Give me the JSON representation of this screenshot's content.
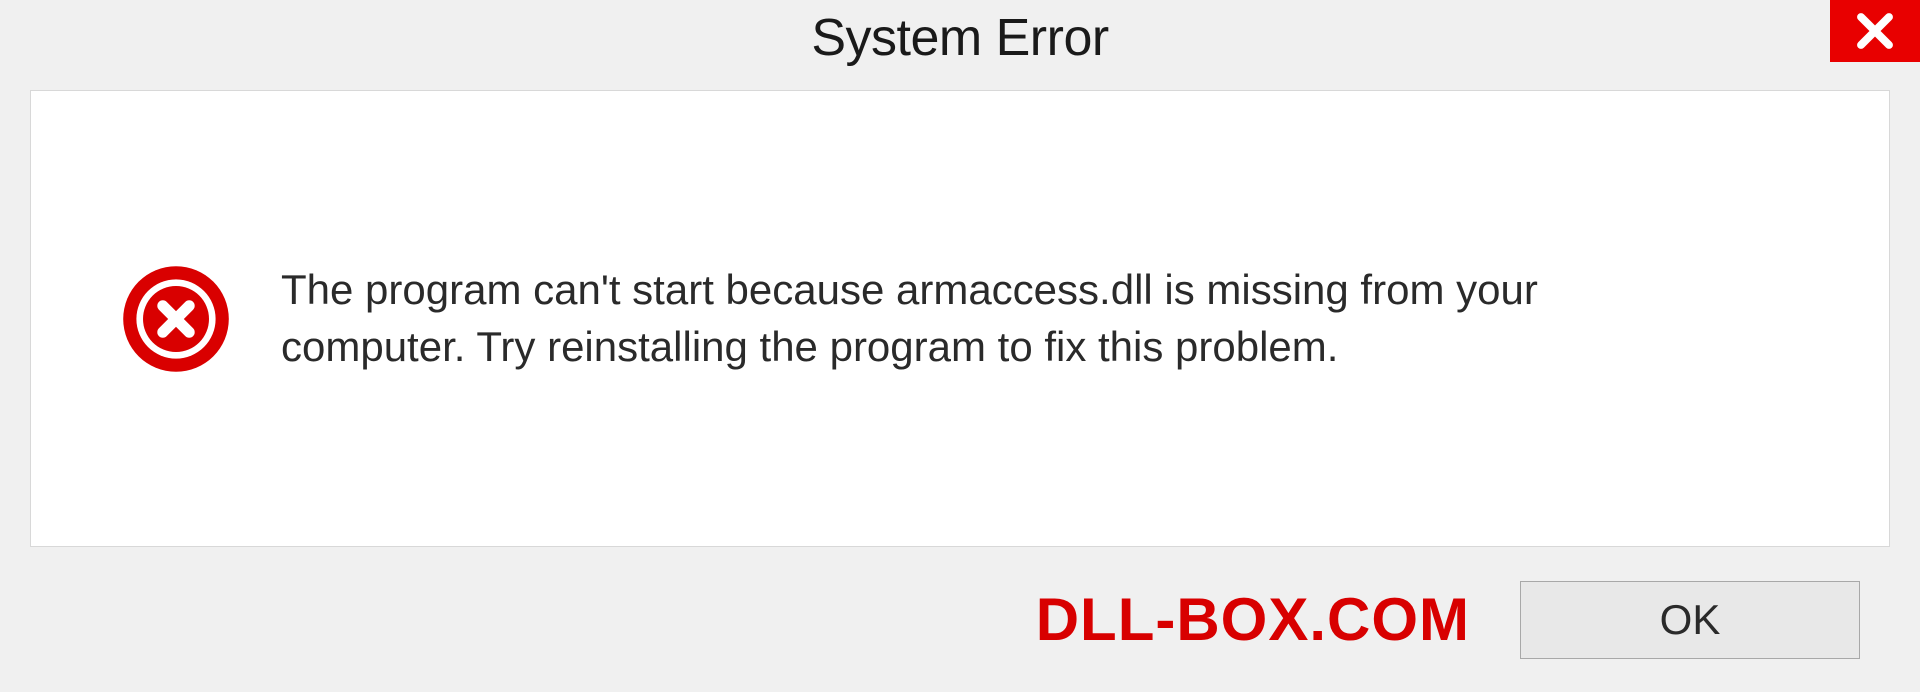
{
  "dialog": {
    "title": "System Error",
    "message": "The program can't start because armaccess.dll is missing from your computer. Try reinstalling the program to fix this problem.",
    "ok_label": "OK"
  },
  "watermark": "DLL-BOX.COM"
}
